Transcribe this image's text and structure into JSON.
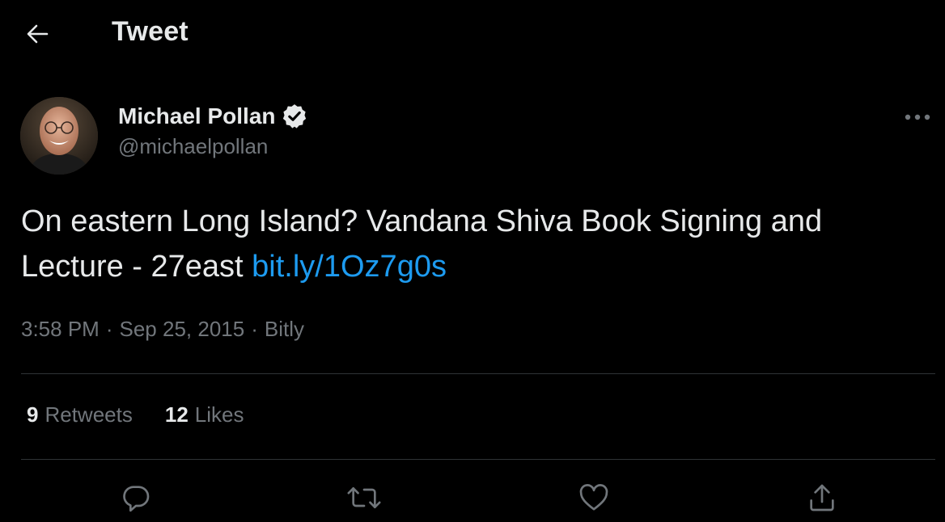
{
  "header": {
    "title": "Tweet",
    "back_icon": "arrow-left-icon"
  },
  "author": {
    "name": "Michael Pollan",
    "handle": "@michaelpollan",
    "verified": true
  },
  "tweet": {
    "text": "On eastern Long Island? Vandana Shiva Book Signing and Lecture - 27east ",
    "link": "bit.ly/1Oz7g0s"
  },
  "meta": {
    "time": "3:58 PM",
    "separator": "·",
    "date": "Sep 25, 2015",
    "source": "Bitly"
  },
  "stats": {
    "retweets_count": "9",
    "retweets_label": "Retweets",
    "likes_count": "12",
    "likes_label": "Likes"
  },
  "actions": [
    "reply-icon",
    "retweet-icon",
    "like-icon",
    "share-icon"
  ],
  "colors": {
    "background": "#000000",
    "text": "#e7e9ea",
    "secondary": "#71767b",
    "link": "#1d9bf0",
    "divider": "#2f3336"
  }
}
